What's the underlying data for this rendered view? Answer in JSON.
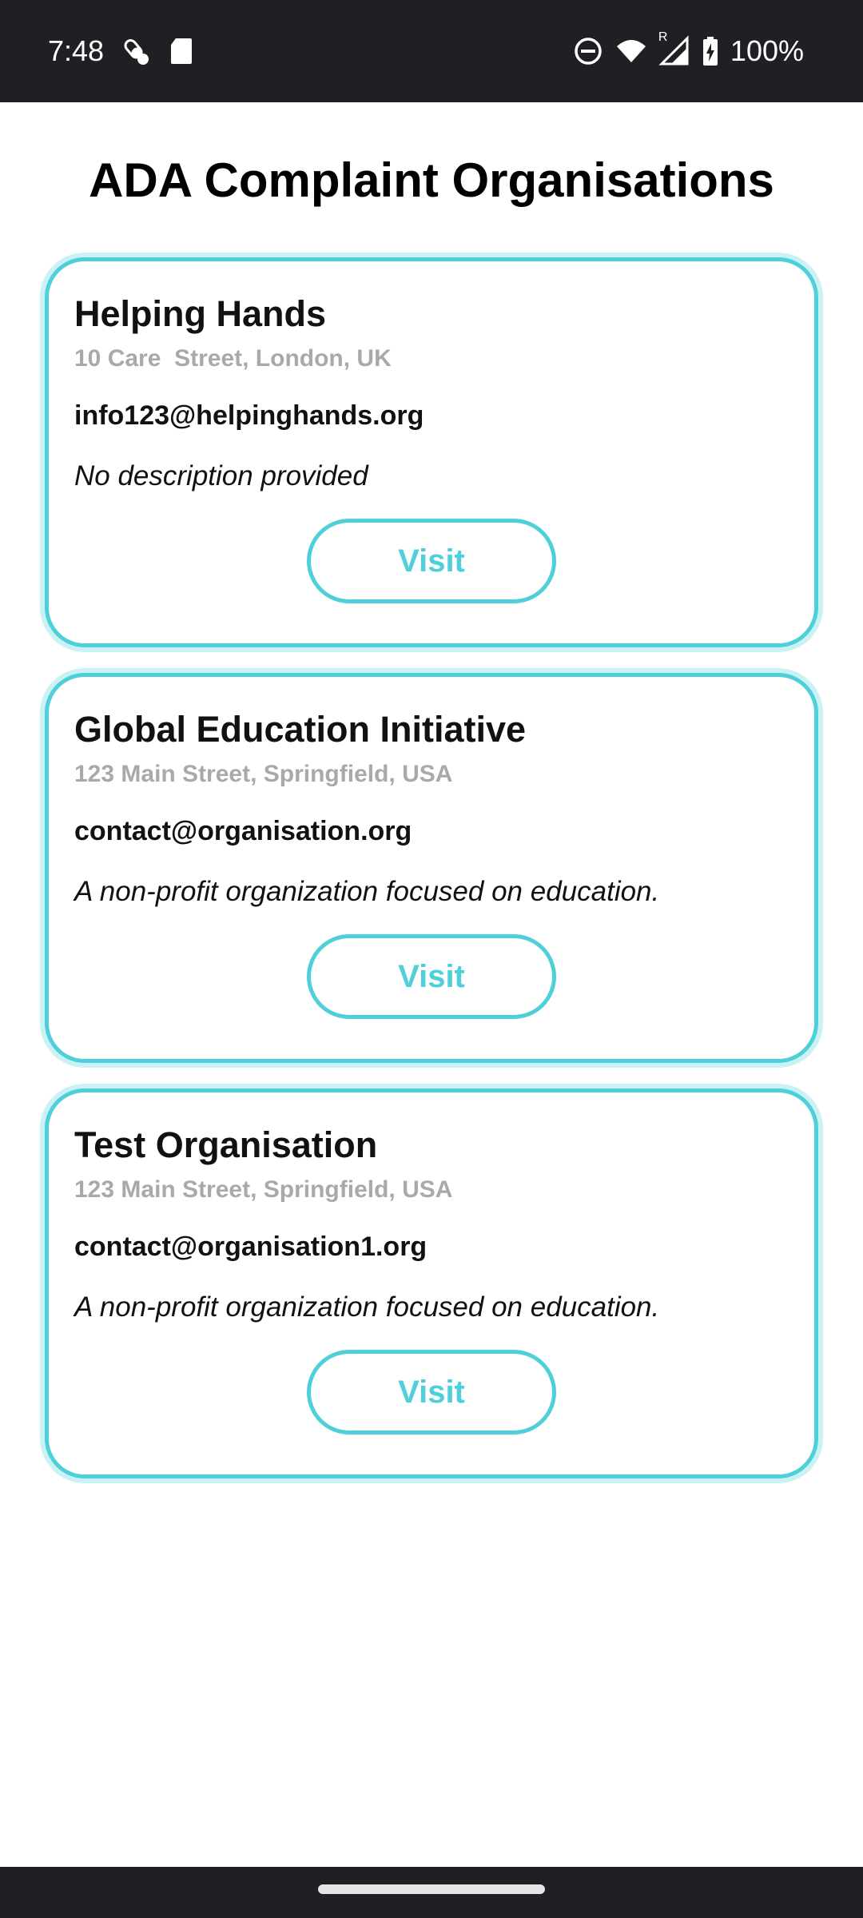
{
  "status_bar": {
    "time": "7:48",
    "battery_percent": "100%",
    "roaming_indicator": "R",
    "icons": [
      "pills-icon",
      "sd-card-icon",
      "do-not-disturb-icon",
      "wifi-icon",
      "signal-icon",
      "battery-charging-icon"
    ]
  },
  "page": {
    "title": "ADA Complaint Organisations"
  },
  "organisations": [
    {
      "name": "Helping Hands",
      "address": "10 Care  Street, London, UK",
      "email": "info123@helpinghands.org",
      "description": "No description provided",
      "button_label": "Visit"
    },
    {
      "name": "Global Education Initiative",
      "address": "123 Main Street, Springfield, USA",
      "email": "contact@organisation.org",
      "description": "A non-profit organization focused on education.",
      "button_label": "Visit"
    },
    {
      "name": "Test Organisation",
      "address": "123 Main Street, Springfield, USA",
      "email": "contact@organisation1.org",
      "description": "A non-profit organization focused on education.",
      "button_label": "Visit"
    }
  ],
  "colors": {
    "accent": "#4ecfd9",
    "status_bar_bg": "#1f2023",
    "address_text": "#a9a9a9"
  }
}
